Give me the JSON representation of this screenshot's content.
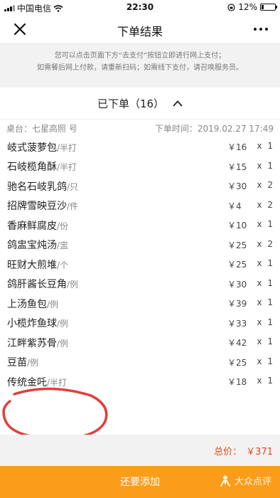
{
  "status_bar": {
    "carrier": "中国电信",
    "time": "22:30",
    "battery": "12%"
  },
  "nav": {
    "title": "下单结果",
    "close_icon": "close-icon",
    "more_icon": "more-icon"
  },
  "notice": {
    "line1": "您可以点击页面下方“去支付”按钮立即进行网上支付；",
    "line2": "如需餐后网上付款，请重新扫码；如需线下支付，请召唤服务员。"
  },
  "order": {
    "header": "已下单（16）",
    "table_label": "桌台：七星高照 号",
    "time_label": "下单时间：2019.02.27 17:49",
    "items": [
      {
        "name": "岐式菠萝包",
        "unit": "/半打",
        "price": "￥16",
        "x": "x",
        "qty": "1"
      },
      {
        "name": "石岐榄角酥",
        "unit": "/半打",
        "price": "￥15",
        "x": "x",
        "qty": "1"
      },
      {
        "name": "驰名石岐乳鸽",
        "unit": "/只",
        "price": "￥30",
        "x": "x",
        "qty": "2"
      },
      {
        "name": "招牌雪映豆沙",
        "unit": "/件",
        "price": "￥4",
        "x": "x",
        "qty": "2"
      },
      {
        "name": "香麻鲜腐皮",
        "unit": "/份",
        "price": "￥10",
        "x": "x",
        "qty": "1"
      },
      {
        "name": "鸽盅宝炖汤",
        "unit": "/盅",
        "price": "￥25",
        "x": "x",
        "qty": "2"
      },
      {
        "name": "旺财大煎堆",
        "unit": "/个",
        "price": "￥25",
        "x": "x",
        "qty": "1"
      },
      {
        "name": "鸽肝酱长豆角",
        "unit": "/例",
        "price": "￥30",
        "x": "x",
        "qty": "1"
      },
      {
        "name": "上汤鱼包",
        "unit": "/例",
        "price": "￥39",
        "x": "x",
        "qty": "1"
      },
      {
        "name": "小榄炸鱼球",
        "unit": "/例",
        "price": "￥33",
        "x": "x",
        "qty": "1"
      },
      {
        "name": "江畔紫苏骨",
        "unit": "/例",
        "price": "￥42",
        "x": "x",
        "qty": "1"
      },
      {
        "name": "豆苗",
        "unit": "/例",
        "price": "￥25",
        "x": "x",
        "qty": "1"
      },
      {
        "name": "传统金吒",
        "unit": "/半打",
        "price": "￥18",
        "x": "x",
        "qty": "1"
      }
    ]
  },
  "total": {
    "label": "总价：",
    "value": "￥371",
    "color": "#e64a19"
  },
  "bottom": {
    "add_label": "还要添加",
    "brand": "大众点评",
    "bar_color": "#fb9d1b"
  }
}
